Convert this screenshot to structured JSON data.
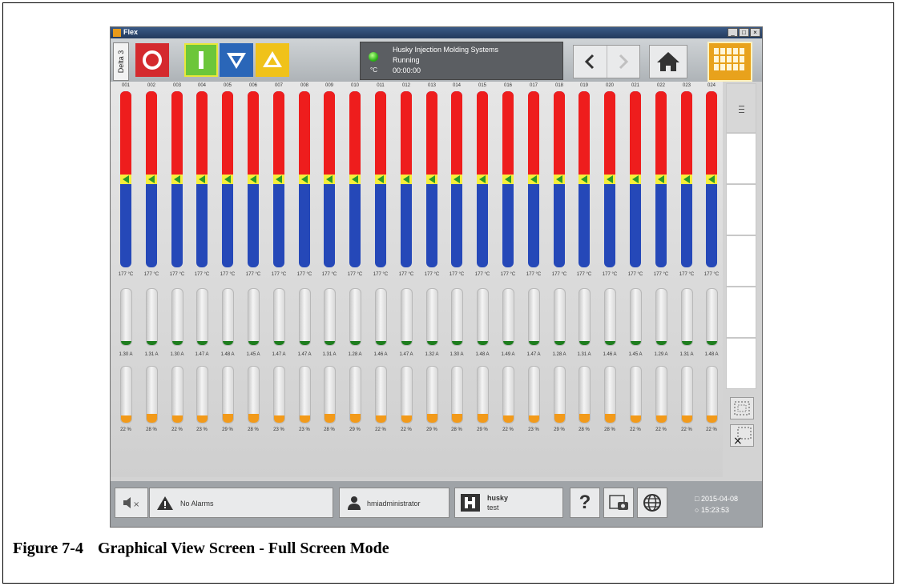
{
  "window": {
    "title": "Flex",
    "controls": [
      "_",
      "□",
      "×"
    ]
  },
  "toolbar": {
    "mold_tab": "Delta 3",
    "status": {
      "company": "Husky Injection Molding Systems",
      "state": "Running",
      "timer": "00:00:00",
      "unit": "°C",
      "led_color": "#2fb51a"
    },
    "icons": [
      "stop-icon",
      "start-icon",
      "standby-down-icon",
      "boost-up-icon",
      "chevron-left-icon",
      "chevron-right-icon",
      "home-icon",
      "grid-view-icon"
    ]
  },
  "zones": [
    {
      "id": "001",
      "temp": "177 °C",
      "current": "1.30 A",
      "percent": "22 %",
      "power": 22
    },
    {
      "id": "002",
      "temp": "177 °C",
      "current": "1.31 A",
      "percent": "28 %",
      "power": 28
    },
    {
      "id": "003",
      "temp": "177 °C",
      "current": "1.30 A",
      "percent": "22 %",
      "power": 22
    },
    {
      "id": "004",
      "temp": "177 °C",
      "current": "1.47 A",
      "percent": "23 %",
      "power": 23
    },
    {
      "id": "005",
      "temp": "177 °C",
      "current": "1.48 A",
      "percent": "29 %",
      "power": 29
    },
    {
      "id": "006",
      "temp": "177 °C",
      "current": "1.45 A",
      "percent": "28 %",
      "power": 28
    },
    {
      "id": "007",
      "temp": "177 °C",
      "current": "1.47 A",
      "percent": "23 %",
      "power": 23
    },
    {
      "id": "008",
      "temp": "177 °C",
      "current": "1.47 A",
      "percent": "23 %",
      "power": 23
    },
    {
      "id": "009",
      "temp": "177 °C",
      "current": "1.31 A",
      "percent": "28 %",
      "power": 28
    },
    {
      "id": "010",
      "temp": "177 °C",
      "current": "1.28 A",
      "percent": "29 %",
      "power": 29
    },
    {
      "id": "011",
      "temp": "177 °C",
      "current": "1.46 A",
      "percent": "22 %",
      "power": 22
    },
    {
      "id": "012",
      "temp": "177 °C",
      "current": "1.47 A",
      "percent": "22 %",
      "power": 22
    },
    {
      "id": "013",
      "temp": "177 °C",
      "current": "1.32 A",
      "percent": "29 %",
      "power": 29
    },
    {
      "id": "014",
      "temp": "177 °C",
      "current": "1.30 A",
      "percent": "28 %",
      "power": 28
    },
    {
      "id": "015",
      "temp": "177 °C",
      "current": "1.48 A",
      "percent": "29 %",
      "power": 29
    },
    {
      "id": "016",
      "temp": "177 °C",
      "current": "1.49 A",
      "percent": "22 %",
      "power": 22
    },
    {
      "id": "017",
      "temp": "177 °C",
      "current": "1.47 A",
      "percent": "23 %",
      "power": 23
    },
    {
      "id": "018",
      "temp": "177 °C",
      "current": "1.28 A",
      "percent": "29 %",
      "power": 29
    },
    {
      "id": "019",
      "temp": "177 °C",
      "current": "1.31 A",
      "percent": "28 %",
      "power": 28
    },
    {
      "id": "020",
      "temp": "177 °C",
      "current": "1.46 A",
      "percent": "28 %",
      "power": 28
    },
    {
      "id": "021",
      "temp": "177 °C",
      "current": "1.45 A",
      "percent": "22 %",
      "power": 22
    },
    {
      "id": "022",
      "temp": "177 °C",
      "current": "1.29 A",
      "percent": "22 %",
      "power": 22
    },
    {
      "id": "023",
      "temp": "177 °C",
      "current": "1.31 A",
      "percent": "22 %",
      "power": 22
    },
    {
      "id": "024",
      "temp": "177 °C",
      "current": "1.48 A",
      "percent": "22 %",
      "power": 22
    }
  ],
  "colors": {
    "above_setpoint": "#ee1d1d",
    "below_setpoint": "#2548b8",
    "setpoint_band": "#f7ee3a",
    "current": "#1e7d1e",
    "output": "#f29a1a",
    "accent": "#e8a21c"
  },
  "statusbar": {
    "alarms": "No Alarms",
    "user": "hmiadministrator",
    "profile_name": "husky",
    "profile_sub": "test",
    "help": "?",
    "date": "2015-04-08",
    "time": "15:23:53"
  },
  "caption": {
    "number": "Figure 7-4",
    "title": "Graphical View Screen - Full Screen Mode"
  }
}
